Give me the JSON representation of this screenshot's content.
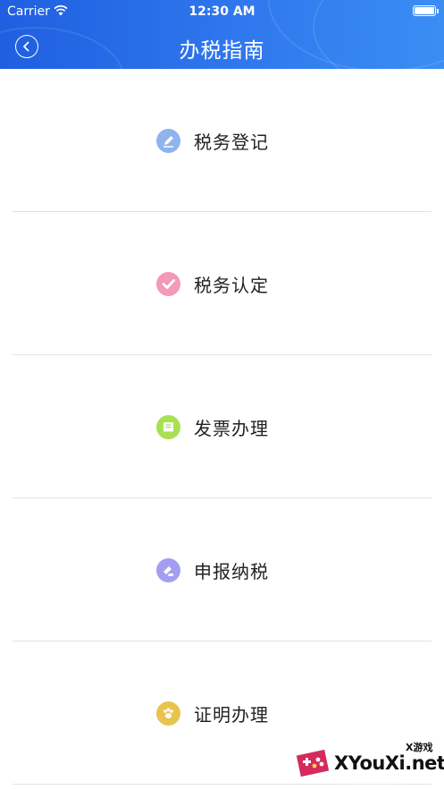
{
  "status_bar": {
    "carrier": "Carrier",
    "time": "12:30 AM"
  },
  "nav": {
    "title": "办税指南",
    "back_icon": "chevron-left-circle-icon"
  },
  "menu_items": [
    {
      "label": "税务登记",
      "icon": "pen-icon",
      "icon_color": "#8fb3ef"
    },
    {
      "label": "税务认定",
      "icon": "check-icon",
      "icon_color": "#f29ab8"
    },
    {
      "label": "发票办理",
      "icon": "receipt-icon",
      "icon_color": "#a7e053"
    },
    {
      "label": "申报纳税",
      "icon": "document-hand-icon",
      "icon_color": "#a49ef0"
    },
    {
      "label": "证明办理",
      "icon": "paw-icon",
      "icon_color": "#e8c44e"
    }
  ],
  "watermark": {
    "small_text": "X游戏",
    "big_text": "XYouXi.net"
  },
  "colors": {
    "header_start": "#1f5fe0",
    "header_end": "#3b8df3",
    "divider": "#e3e3e3"
  }
}
